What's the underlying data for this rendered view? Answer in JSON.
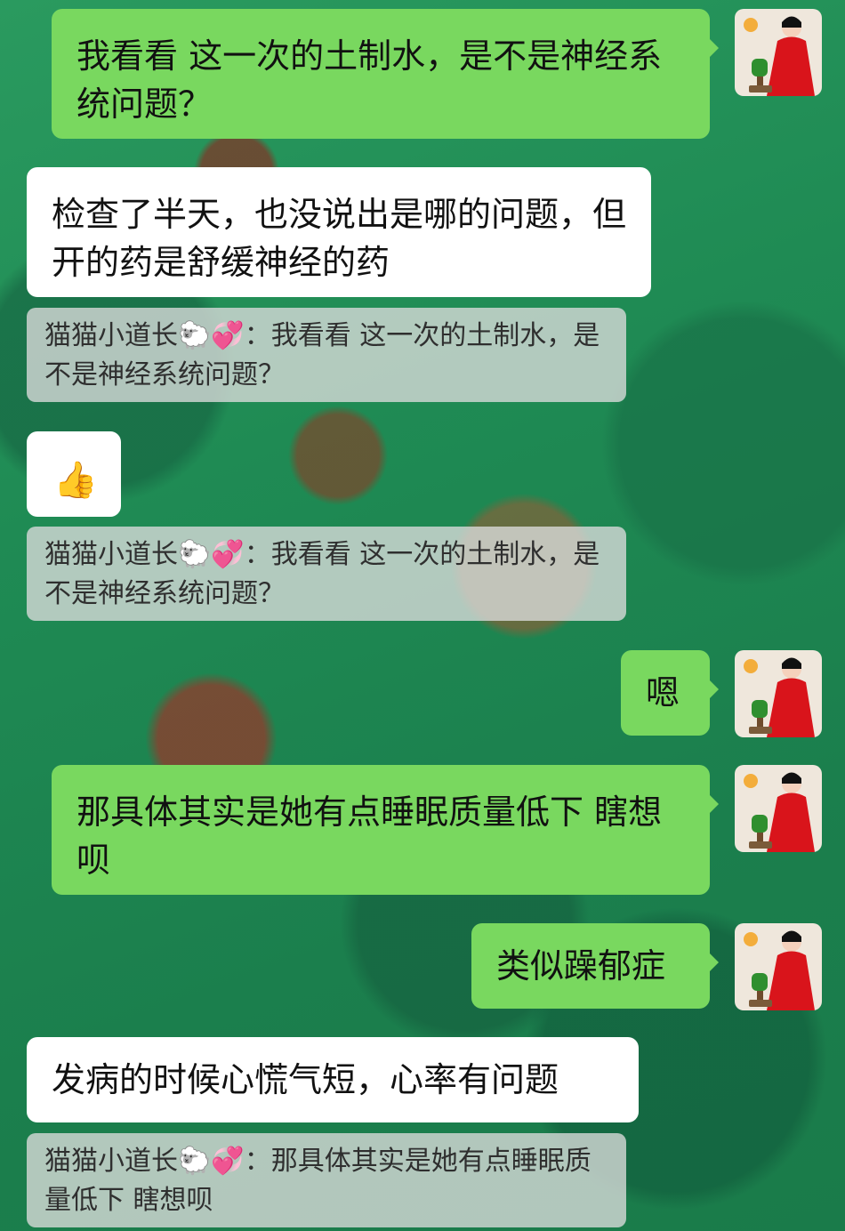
{
  "messages": {
    "m1": "我看看  这一次的土制水，是不是神经系统问题？",
    "m2": "检查了半天，也没说出是哪的问题，但开的药是舒缓神经的药",
    "q1": "猫猫小道长🐑💞：我看看  这一次的土制水，是不是神经系统问题？",
    "m3": "👍",
    "q2": "猫猫小道长🐑💞：我看看  这一次的土制水，是不是神经系统问题？",
    "m4": "嗯",
    "m5": "那具体其实是她有点睡眠质量低下  瞎想呗",
    "m6": "类似躁郁症",
    "m7": "发病的时候心慌气短，心率有问题",
    "q3": "猫猫小道长🐑💞：那具体其实是她有点睡眠质量低下  瞎想呗"
  },
  "colors": {
    "outgoing_bubble": "#79d85f",
    "incoming_bubble": "#ffffff",
    "quote_bubble": "#dcdcdc",
    "background": "#1f8a52"
  }
}
